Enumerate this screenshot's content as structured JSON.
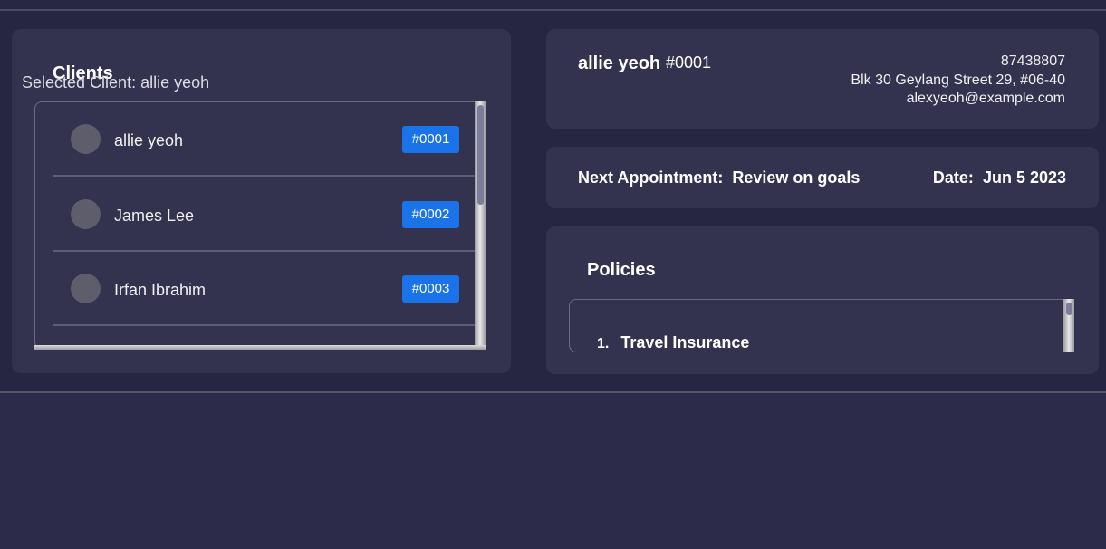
{
  "clients": {
    "title": "Clients",
    "items": [
      {
        "name": "allie yeoh",
        "id": "#0001"
      },
      {
        "name": "James Lee",
        "id": "#0002"
      },
      {
        "name": "Irfan Ibrahim",
        "id": "#0003"
      }
    ]
  },
  "detail": {
    "name": "allie yeoh",
    "id": "#0001",
    "phone": "87438807",
    "address": "Blk 30 Geylang Street 29, #06-40",
    "email": "alexyeoh@example.com"
  },
  "appointment": {
    "label": "Next Appointment:",
    "value": "Review on goals",
    "date_label": "Date:",
    "date_value": "Jun 5 2023"
  },
  "policies": {
    "title": "Policies",
    "items": [
      {
        "number": "1.",
        "name": "Travel Insurance"
      }
    ]
  },
  "status": {
    "text": "Selected Client: allie yeoh"
  },
  "colors": {
    "background": "#272744",
    "panel": "#33334f",
    "badge": "#1a73e8"
  }
}
